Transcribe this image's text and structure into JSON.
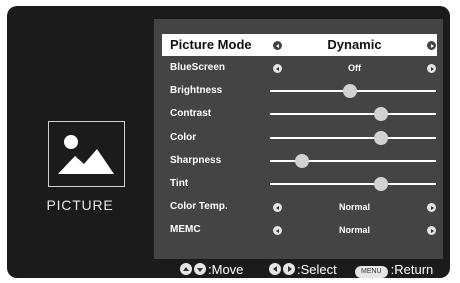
{
  "side": {
    "label": "PICTURE",
    "icon": "picture-icon"
  },
  "menu": {
    "header": {
      "label": "Picture Mode",
      "value": "Dynamic"
    },
    "rows": [
      {
        "label": "BlueScreen",
        "type": "select",
        "value": "Off"
      },
      {
        "label": "Brightness",
        "type": "slider",
        "level": 0.48
      },
      {
        "label": "Contrast",
        "type": "slider",
        "level": 0.67
      },
      {
        "label": "Color",
        "type": "slider",
        "level": 0.67
      },
      {
        "label": "Sharpness",
        "type": "slider",
        "level": 0.19
      },
      {
        "label": "Tint",
        "type": "slider",
        "level": 0.67
      },
      {
        "label": "Color Temp.",
        "type": "select",
        "value": "Normal"
      },
      {
        "label": "MEMC",
        "type": "select",
        "value": "Normal"
      }
    ]
  },
  "footer": {
    "move": ":Move",
    "select": ":Select",
    "menu_key": "MENU",
    "return": ":Return"
  },
  "colors": {
    "screen": "#1b1b1b",
    "panel": "#444444",
    "highlight": "#ffffff"
  }
}
